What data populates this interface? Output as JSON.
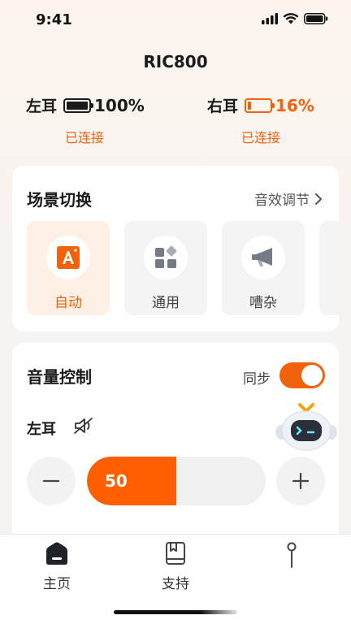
{
  "status_bar": {
    "time": "9:41"
  },
  "device": {
    "name": "RIC800"
  },
  "ears": {
    "left": {
      "label": "左耳",
      "battery_percent": "100%",
      "battery_level": 1.0,
      "status": "已连接"
    },
    "right": {
      "label": "右耳",
      "battery_percent": "16%",
      "battery_level": 0.16,
      "status": "已连接"
    }
  },
  "scene": {
    "title": "场景切换",
    "sound_link": "音效调节",
    "items": [
      {
        "label": "自动",
        "icon": "auto-a-icon",
        "active": true
      },
      {
        "label": "通用",
        "icon": "grid-icon",
        "active": false
      },
      {
        "label": "嘈杂",
        "icon": "megaphone-icon",
        "active": false
      }
    ]
  },
  "volume": {
    "title": "音量控制",
    "sync_label": "同步",
    "sync_on": true,
    "left_label": "左耳",
    "left_muted": true,
    "left_value": "50",
    "left_fraction": 0.5
  },
  "tabs": [
    {
      "label": "主页",
      "icon": "home-icon",
      "active": true
    },
    {
      "label": "支持",
      "icon": "book-icon",
      "active": false
    },
    {
      "label": "",
      "icon": "location-pin-icon",
      "active": false
    }
  ],
  "colors": {
    "accent": "#f2620c",
    "slider": "#ff5f00",
    "text": "#1b1b1b",
    "card": "#ffffff"
  }
}
